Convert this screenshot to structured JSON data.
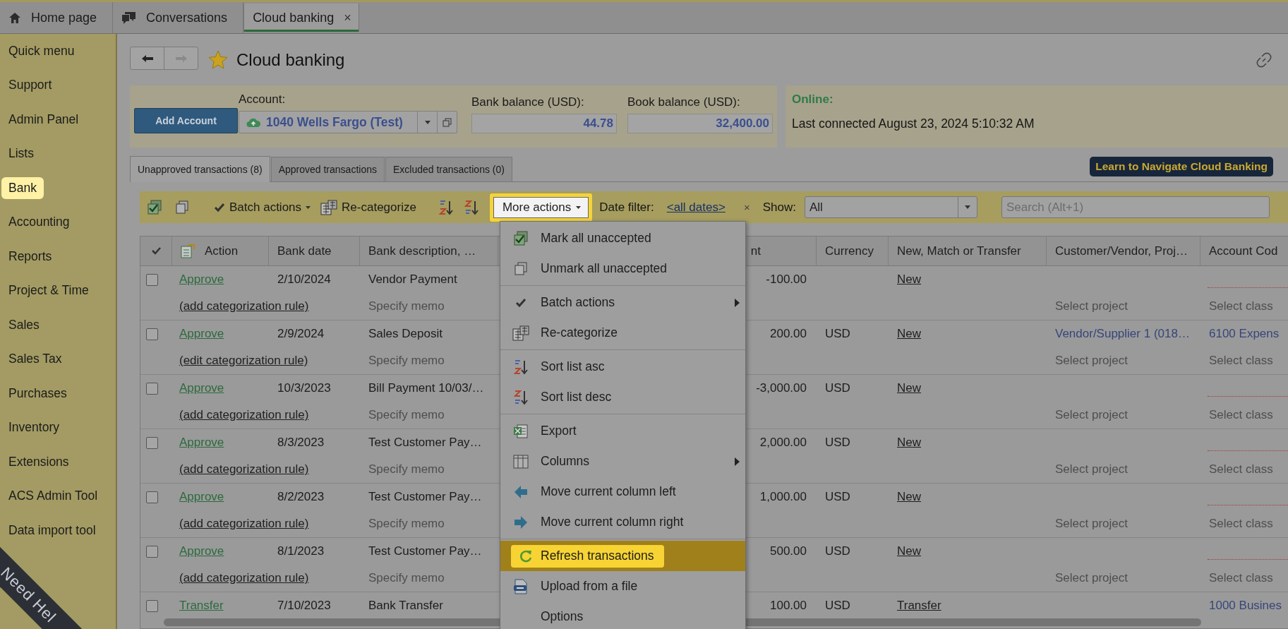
{
  "tabs": [
    {
      "label": "Home page",
      "kind": "home",
      "selected": false,
      "closable": false
    },
    {
      "label": "Conversations",
      "kind": "chat",
      "selected": false,
      "closable": false
    },
    {
      "label": "Cloud banking",
      "kind": "plain",
      "selected": true,
      "closable": true,
      "close_glyph": "×"
    }
  ],
  "sidebar": {
    "items": [
      {
        "label": "Quick menu",
        "highlighted": false
      },
      {
        "label": "Support",
        "highlighted": false
      },
      {
        "label": "Admin Panel",
        "highlighted": false
      },
      {
        "label": "Lists",
        "highlighted": false
      },
      {
        "label": "Bank",
        "highlighted": true
      },
      {
        "label": "Accounting",
        "highlighted": false
      },
      {
        "label": "Reports",
        "highlighted": false
      },
      {
        "label": "Project & Time",
        "highlighted": false
      },
      {
        "label": "Sales",
        "highlighted": false
      },
      {
        "label": "Sales Tax",
        "highlighted": false
      },
      {
        "label": "Purchases",
        "highlighted": false
      },
      {
        "label": "Inventory",
        "highlighted": false
      },
      {
        "label": "Extensions",
        "highlighted": false
      },
      {
        "label": "ACS Admin Tool",
        "highlighted": false
      },
      {
        "label": "Data import tool",
        "highlighted": false
      }
    ]
  },
  "help_ribbon": "Need Hel",
  "page": {
    "title": "Cloud banking",
    "favorite": true
  },
  "account_panel": {
    "add_account_button": "Add Account",
    "account_label": "Account:",
    "account_value": "1040 Wells Fargo (Test)",
    "bank_balance_label": "Bank balance (USD):",
    "bank_balance": "44.78",
    "book_balance_label": "Book balance (USD):",
    "book_balance": "32,400.00"
  },
  "online_panel": {
    "status": "Online:",
    "last_connected": "Last connected August 23, 2024 5:10:32 AM"
  },
  "view_tabs": [
    {
      "label": "Unapproved transactions (8)",
      "selected": true
    },
    {
      "label": "Approved transactions",
      "selected": false
    },
    {
      "label": "Excluded transactions (0)",
      "selected": false
    }
  ],
  "learn_button": "Learn to Navigate Cloud Banking",
  "toolbar": {
    "batch_actions": "Batch actions",
    "recategorize": "Re-categorize",
    "more_actions": {
      "label": "More actions",
      "highlighted": true
    },
    "date_filter_label": "Date filter:",
    "date_filter_value": "<all dates>",
    "clear_filter": "×",
    "show_label": "Show:",
    "show_value": "All",
    "search": {
      "placeholder": "Search (Alt+1)"
    }
  },
  "table": {
    "columns": [
      "Action",
      "Bank date",
      "Bank description, …",
      "nt",
      "Currency",
      "New, Match or Transfer",
      "Customer/Vendor, Proj…",
      "Account Cod"
    ],
    "rows": [
      {
        "checked": false,
        "action": "Approve",
        "date": "2/10/2024",
        "description": "Vendor Payment",
        "amount": "-100.00",
        "match": "New",
        "rule": "(add categorization rule)",
        "memo": "Specify memo",
        "project": "Select project",
        "class": "Select class"
      },
      {
        "checked": false,
        "action": "Approve",
        "date": "2/9/2024",
        "description": "Sales Deposit",
        "amount": "200.00",
        "currency": "USD",
        "match": "New",
        "customer": "Vendor/Supplier 1 (018…",
        "account": "6100 Expens",
        "rule": "(edit categorization rule)",
        "memo": "Specify memo",
        "project": "Select project",
        "class": "Select class"
      },
      {
        "checked": false,
        "action": "Approve",
        "date": "10/3/2023",
        "description": "Bill Payment 10/03/…",
        "amount": "-3,000.00",
        "currency": "USD",
        "match": "New",
        "rule": "(add categorization rule)",
        "memo": "Specify memo",
        "project": "Select project",
        "class": "Select class"
      },
      {
        "checked": false,
        "action": "Approve",
        "date": "8/3/2023",
        "description": "Test Customer Pay…",
        "amount": "2,000.00",
        "currency": "USD",
        "match": "New",
        "rule": "(add categorization rule)",
        "memo": "Specify memo",
        "project": "Select project",
        "class": "Select class"
      },
      {
        "checked": false,
        "action": "Approve",
        "date": "8/2/2023",
        "description": "Test Customer Pay…",
        "amount": "1,000.00",
        "currency": "USD",
        "match": "New",
        "rule": "(add categorization rule)",
        "memo": "Specify memo",
        "project": "Select project",
        "class": "Select class"
      },
      {
        "checked": false,
        "action": "Approve",
        "date": "8/1/2023",
        "description": "Test Customer Pay…",
        "amount": "500.00",
        "currency": "USD",
        "match": "New",
        "rule": "(add categorization rule)",
        "memo": "Specify memo",
        "project": "Select project",
        "class": "Select class"
      },
      {
        "checked": false,
        "action": "Transfer",
        "date": "7/10/2023",
        "description": "Bank Transfer",
        "amount": "100.00",
        "currency": "USD",
        "match": "Transfer",
        "account": "1000 Busines"
      }
    ]
  },
  "menu": {
    "groups": [
      [
        {
          "label": "Mark all unaccepted",
          "kind": "check-double",
          "submenu": false,
          "highlighted": false
        },
        {
          "label": "Unmark all unaccepted",
          "kind": "copy",
          "submenu": false,
          "highlighted": false
        }
      ],
      [
        {
          "label": "Batch actions",
          "kind": "check",
          "submenu": true,
          "highlighted": false
        },
        {
          "label": "Re-categorize",
          "kind": "grid",
          "submenu": false,
          "highlighted": false
        }
      ],
      [
        {
          "label": "Sort list asc",
          "kind": "sort-asc",
          "submenu": false,
          "highlighted": false
        },
        {
          "label": "Sort list desc",
          "kind": "sort-desc",
          "submenu": false,
          "highlighted": false
        }
      ],
      [
        {
          "label": "Export",
          "kind": "sheet",
          "submenu": false,
          "highlighted": false
        },
        {
          "label": "Columns",
          "kind": "columns",
          "submenu": true,
          "highlighted": false
        },
        {
          "label": "Move current column left",
          "kind": "arrow-left",
          "submenu": false,
          "highlighted": false
        },
        {
          "label": "Move current column right",
          "kind": "arrow-right",
          "submenu": false,
          "highlighted": false
        }
      ],
      [
        {
          "label": "Refresh transactions",
          "kind": "refresh",
          "submenu": false,
          "highlighted": true
        },
        {
          "label": "Upload from a file",
          "kind": "upload",
          "submenu": false,
          "highlighted": false
        },
        {
          "label": "Options",
          "kind": "plain",
          "submenu": false,
          "highlighted": false
        }
      ]
    ]
  }
}
